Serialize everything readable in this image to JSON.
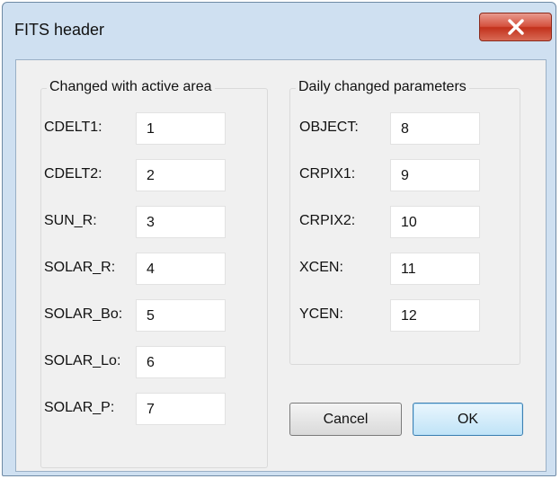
{
  "window": {
    "title": "FITS header"
  },
  "left_group": {
    "title": "Changed with active area",
    "fields": [
      {
        "label": "CDELT1:",
        "value": "1"
      },
      {
        "label": "CDELT2:",
        "value": "2"
      },
      {
        "label": "SUN_R:",
        "value": "3"
      },
      {
        "label": "SOLAR_R:",
        "value": "4"
      },
      {
        "label": "SOLAR_Bo:",
        "value": "5"
      },
      {
        "label": "SOLAR_Lo:",
        "value": "6"
      },
      {
        "label": "SOLAR_P:",
        "value": "7"
      }
    ]
  },
  "right_group": {
    "title": "Daily changed parameters",
    "fields": [
      {
        "label": "OBJECT:",
        "value": "8"
      },
      {
        "label": "CRPIX1:",
        "value": "9"
      },
      {
        "label": "CRPIX2:",
        "value": "10"
      },
      {
        "label": "XCEN:",
        "value": "11"
      },
      {
        "label": "YCEN:",
        "value": "12"
      }
    ]
  },
  "buttons": {
    "cancel_label": "Cancel",
    "ok_label": "OK"
  },
  "icons": {
    "close": "close-icon"
  },
  "colors": {
    "close_button": "#c9442e",
    "ok_button_border": "#3c7fb1",
    "frame": "#cfe0f1"
  }
}
